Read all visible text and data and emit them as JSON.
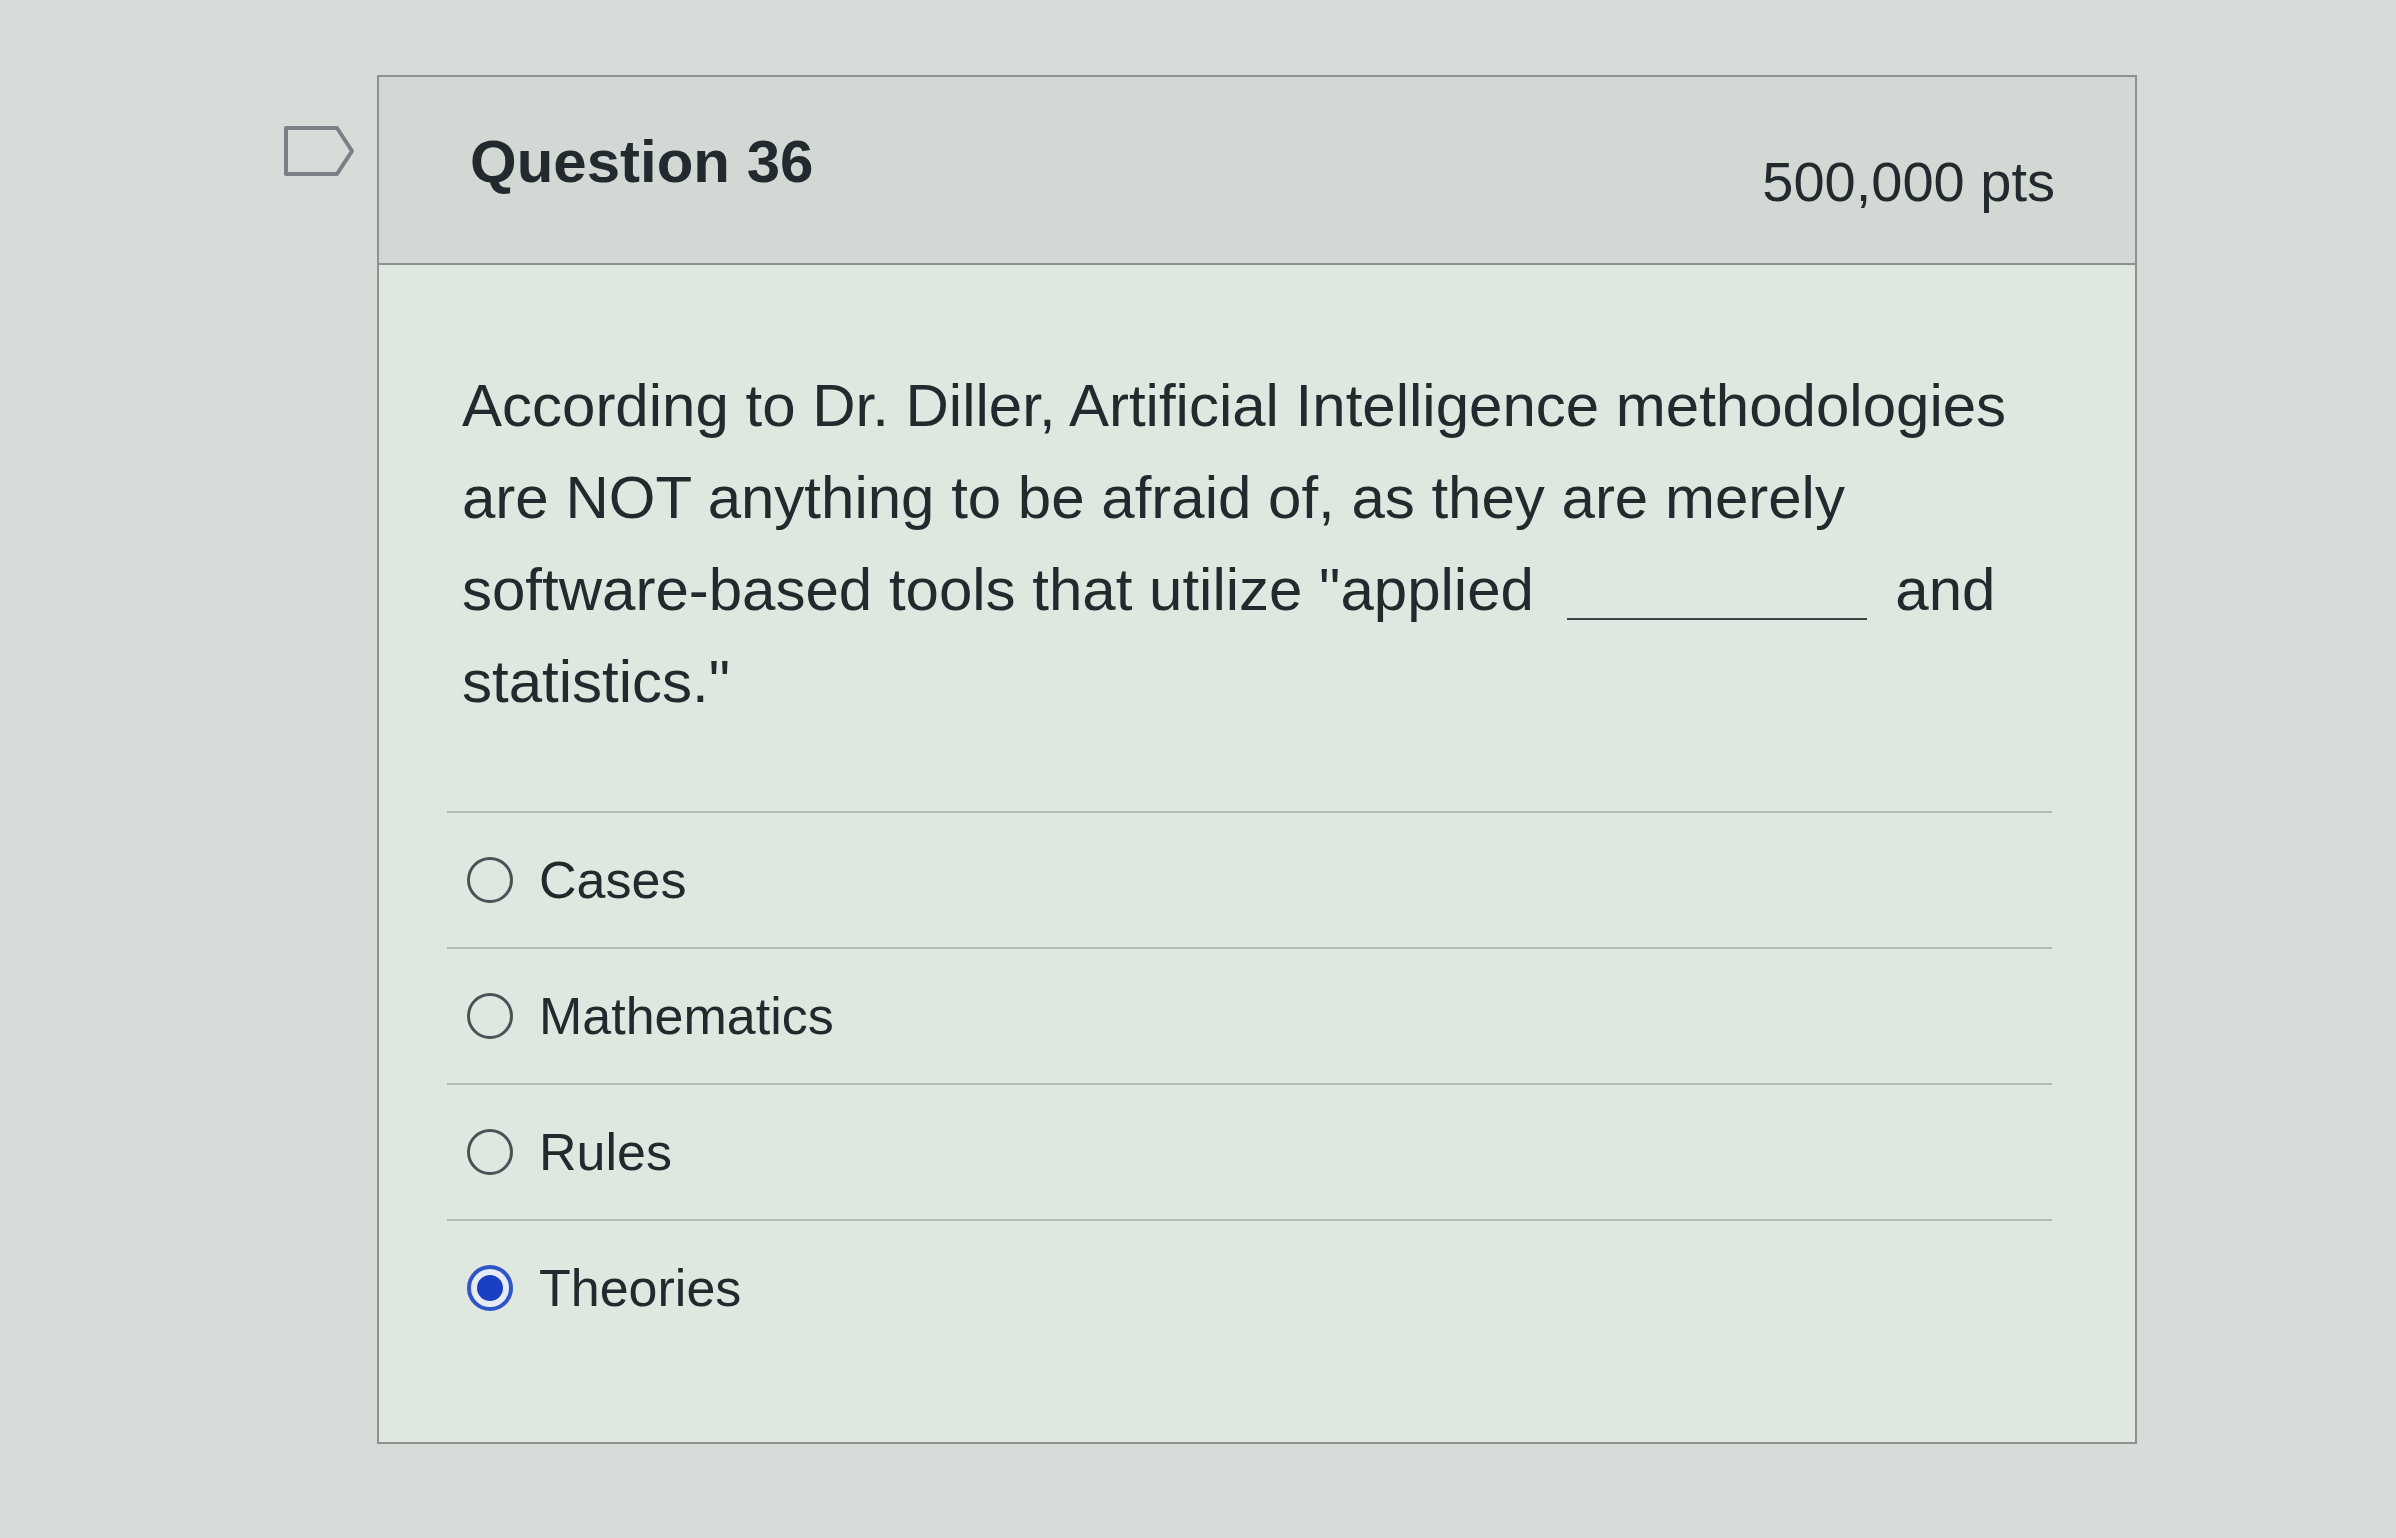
{
  "question": {
    "title": "Question 36",
    "points": "500,000 pts",
    "flagged": false
  },
  "prompt": {
    "text_before": "According to Dr. Diller, Artificial Intelligence methodologies are NOT anything to be afraid of, as they are merely software-based tools that utilize \"applied",
    "text_after": "and statistics.\""
  },
  "answers": [
    {
      "label": "Cases",
      "selected": false
    },
    {
      "label": "Mathematics",
      "selected": false
    },
    {
      "label": "Rules",
      "selected": false
    },
    {
      "label": "Theories",
      "selected": true
    }
  ]
}
